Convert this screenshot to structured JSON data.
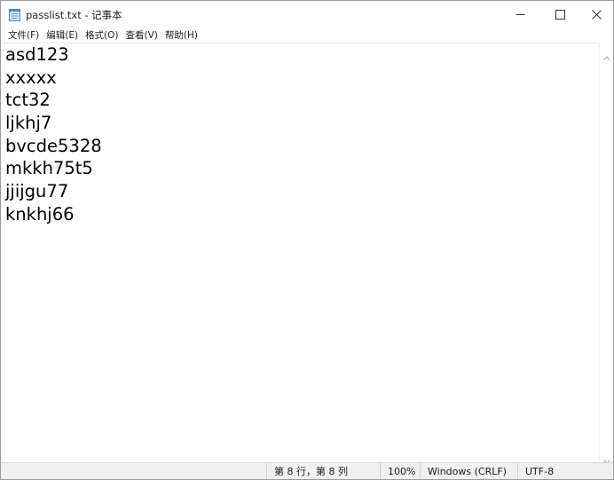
{
  "window": {
    "title": "passlist.txt - 记事本",
    "app_icon": "notepad-icon"
  },
  "window_controls": {
    "minimize_icon": "minimize-icon",
    "maximize_icon": "maximize-icon",
    "close_icon": "close-icon"
  },
  "menu": {
    "items": [
      {
        "label": "文件(F)"
      },
      {
        "label": "编辑(E)"
      },
      {
        "label": "格式(O)"
      },
      {
        "label": "查看(V)"
      },
      {
        "label": "帮助(H)"
      }
    ]
  },
  "editor": {
    "lines": [
      "asd123",
      "xxxxx",
      "tct32",
      "ljkhj7",
      "bvcde5328",
      "mkkh75t5",
      "jjijgu77",
      "knkhj66"
    ]
  },
  "scrollbar": {
    "up_icon": "scroll-up-arrow-icon",
    "down_icon": "scroll-down-arrow-icon"
  },
  "status": {
    "position": "第 8 行，第 8 列",
    "zoom": "100%",
    "line_ending": "Windows (CRLF)",
    "encoding": "UTF-8"
  }
}
